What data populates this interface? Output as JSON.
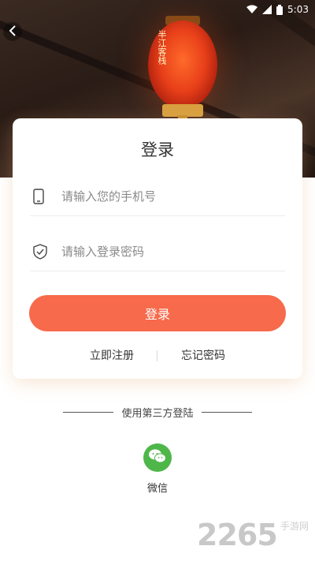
{
  "status_bar": {
    "time": "5:03"
  },
  "hero": {
    "lantern_text": "半江客栈"
  },
  "login_card": {
    "title": "登录",
    "phone_placeholder": "请输入您的手机号",
    "password_placeholder": "请输入登录密码",
    "login_button": "登录",
    "register_link": "立即注册",
    "forgot_link": "忘记密码"
  },
  "third_party": {
    "label": "使用第三方登陆",
    "wechat_label": "微信"
  },
  "watermark": {
    "digits": "2265",
    "site": "手游网"
  },
  "colors": {
    "accent": "#f76a4c",
    "wechat": "#4fb74a"
  },
  "icons": [
    "back-icon",
    "wifi-icon",
    "signal-icon",
    "battery-icon",
    "phone-icon",
    "shield-icon",
    "wechat-icon"
  ]
}
